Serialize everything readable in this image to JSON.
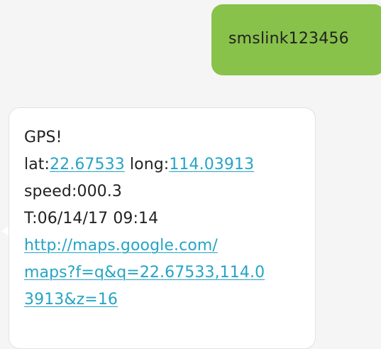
{
  "outgoing": {
    "text": "smslink123456"
  },
  "incoming": {
    "line1": "GPS!",
    "lat_label": "lat:",
    "lat_value": "22.67533",
    "long_label": " long:",
    "long_value": "114.03913",
    "speed_line": "speed:000.3",
    "time_line": "T:06/14/17 09:14",
    "url_lines": [
      "http://maps.google.com/",
      "maps?f=q&q=22.67533,114.0",
      "3913&z=16"
    ]
  },
  "colors": {
    "outgoing_bubble": "#88c24a",
    "incoming_bubble": "#ffffff",
    "link": "#26a4c6",
    "background": "#f5f5f5"
  }
}
